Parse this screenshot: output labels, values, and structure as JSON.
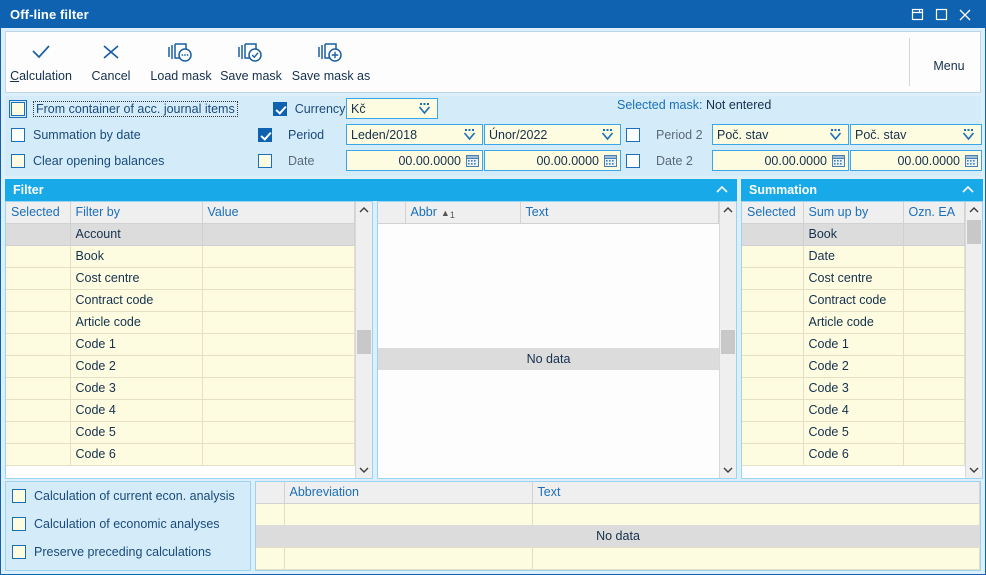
{
  "window": {
    "title": "Off-line filter",
    "controls": [
      {
        "name": "restore-down-button",
        "glyph": "restore"
      },
      {
        "name": "maximize-button",
        "glyph": "maximize"
      },
      {
        "name": "close-button",
        "glyph": "close"
      }
    ]
  },
  "toolbar": {
    "items": [
      {
        "label": "Calculation",
        "accel": "C",
        "icon": "check-icon"
      },
      {
        "label": "Cancel",
        "accel": "",
        "icon": "cross-icon"
      },
      {
        "label": "Load mask",
        "accel": "",
        "icon": "mask-load-icon"
      },
      {
        "label": "Save mask",
        "accel": "",
        "icon": "mask-save-icon"
      },
      {
        "label": "Save mask as",
        "accel": "",
        "icon": "mask-save-as-icon"
      }
    ],
    "menu_label": "Menu"
  },
  "criteria": {
    "left_checks": [
      {
        "label": "From container of acc. journal items",
        "checked": false,
        "focused": true,
        "style": "cream"
      },
      {
        "label": "Summation by date",
        "checked": false,
        "focused": false,
        "style": "white"
      },
      {
        "label": "Clear opening balances",
        "checked": false,
        "focused": false,
        "style": "cream"
      }
    ],
    "mid_checks": [
      {
        "label": "Currency",
        "checked": true
      },
      {
        "label": "Period",
        "checked": true
      },
      {
        "label": "Date",
        "checked": false
      }
    ],
    "second_checks": [
      {
        "label": "Period 2",
        "checked": false
      },
      {
        "label": "Date 2",
        "checked": false
      }
    ],
    "fields": {
      "currency": "Kč",
      "period_from": "Leden/2018",
      "period_to": "Únor/2022",
      "date_from": "00.00.0000",
      "date_to": "00.00.0000",
      "period2_from": "Poč. stav",
      "period2_to": "Poč. stav",
      "date2_from": "00.00.0000",
      "date2_to": "00.00.0000"
    },
    "selected_mask_label": "Selected mask:",
    "selected_mask_value": "Not entered"
  },
  "filter_panel": {
    "title": "Filter",
    "columns": [
      "Selected",
      "Filter by",
      "Value"
    ],
    "rows": [
      {
        "selected": "",
        "filter_by": "Account",
        "value": "",
        "highlighted": true
      },
      {
        "selected": "",
        "filter_by": "Book",
        "value": "",
        "highlighted": false
      },
      {
        "selected": "",
        "filter_by": "Cost centre",
        "value": "",
        "highlighted": false
      },
      {
        "selected": "",
        "filter_by": "Contract code",
        "value": "",
        "highlighted": false
      },
      {
        "selected": "",
        "filter_by": "Article code",
        "value": "",
        "highlighted": false
      },
      {
        "selected": "",
        "filter_by": "Code 1",
        "value": "",
        "highlighted": false
      },
      {
        "selected": "",
        "filter_by": "Code 2",
        "value": "",
        "highlighted": false
      },
      {
        "selected": "",
        "filter_by": "Code 3",
        "value": "",
        "highlighted": false
      },
      {
        "selected": "",
        "filter_by": "Code 4",
        "value": "",
        "highlighted": false
      },
      {
        "selected": "",
        "filter_by": "Code 5",
        "value": "",
        "highlighted": false
      },
      {
        "selected": "",
        "filter_by": "Code 6",
        "value": "",
        "highlighted": false
      }
    ]
  },
  "detail_panel": {
    "columns": [
      "",
      "Abbr",
      "Text"
    ],
    "sort_column": "Abbr",
    "sort_direction": "asc",
    "sort_order": "1",
    "empty_text": "No data"
  },
  "summation_panel": {
    "title": "Summation",
    "columns": [
      "Selected",
      "Sum up by",
      "Ozn. EA"
    ],
    "rows": [
      {
        "selected": "",
        "sum_up_by": "Book",
        "ozn": "",
        "highlighted": true
      },
      {
        "selected": "",
        "sum_up_by": "Date",
        "ozn": "",
        "highlighted": false
      },
      {
        "selected": "",
        "sum_up_by": "Cost centre",
        "ozn": "",
        "highlighted": false
      },
      {
        "selected": "",
        "sum_up_by": "Contract code",
        "ozn": "",
        "highlighted": false
      },
      {
        "selected": "",
        "sum_up_by": "Article code",
        "ozn": "",
        "highlighted": false
      },
      {
        "selected": "",
        "sum_up_by": "Code 1",
        "ozn": "",
        "highlighted": false
      },
      {
        "selected": "",
        "sum_up_by": "Code 2",
        "ozn": "",
        "highlighted": false
      },
      {
        "selected": "",
        "sum_up_by": "Code 3",
        "ozn": "",
        "highlighted": false
      },
      {
        "selected": "",
        "sum_up_by": "Code 4",
        "ozn": "",
        "highlighted": false
      },
      {
        "selected": "",
        "sum_up_by": "Code 5",
        "ozn": "",
        "highlighted": false
      },
      {
        "selected": "",
        "sum_up_by": "Code 6",
        "ozn": "",
        "highlighted": false
      }
    ]
  },
  "bottom": {
    "checks": [
      {
        "label": "Calculation of current econ. analysis",
        "checked": false
      },
      {
        "label": "Calculation of economic analyses",
        "checked": false
      },
      {
        "label": "Preserve preceding calculations",
        "checked": false
      }
    ],
    "columns": [
      "",
      "Abbreviation",
      "Text"
    ],
    "empty_text": "No data"
  },
  "colors": {
    "title_bar": "#0f62b0",
    "panel_header": "#17a9e8",
    "field_bg": "#fdfce0",
    "field_border": "#3aa6e8",
    "criteria_bg": "#d4ecfa",
    "row_selected": "#dcdcdc"
  }
}
